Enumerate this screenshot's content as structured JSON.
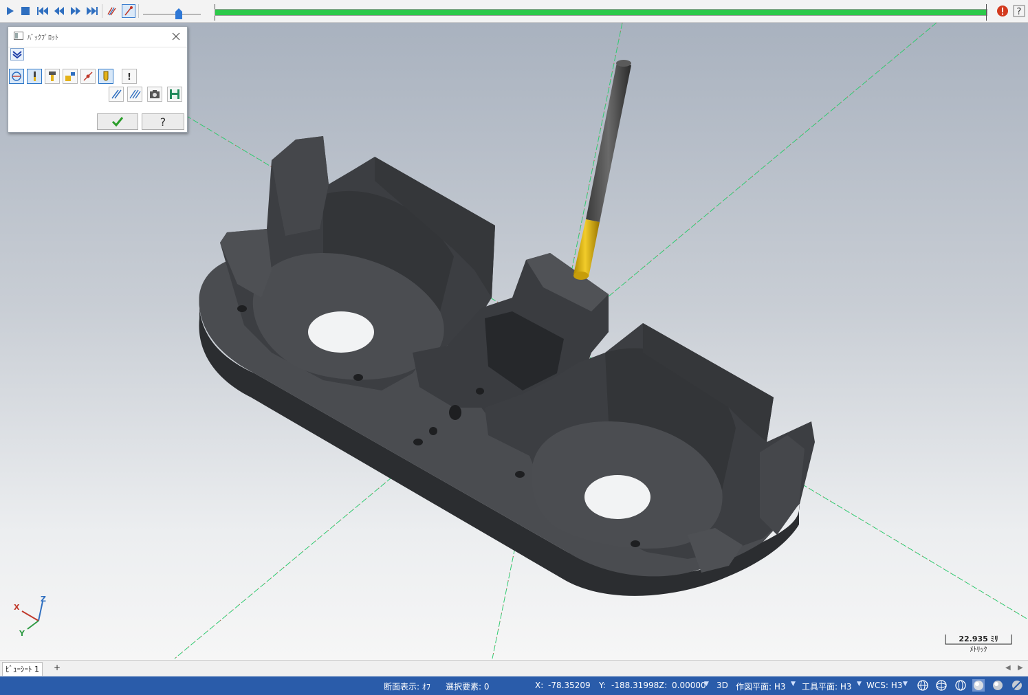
{
  "toolbar": {
    "buttons": [
      {
        "name": "play-icon"
      },
      {
        "name": "stop-icon"
      },
      {
        "name": "skip-to-start-icon"
      },
      {
        "name": "step-back-icon"
      },
      {
        "name": "step-forward-icon"
      },
      {
        "name": "skip-to-end-icon"
      },
      {
        "name": "toolpath-trace-icon"
      },
      {
        "name": "tool-display-icon"
      }
    ],
    "progress": 1.0,
    "speed": 0.62,
    "accent_color": "#2cc94a"
  },
  "dialog": {
    "title": "ﾊﾞｯｸﾌﾟﾛｯﾄ",
    "row1_icons": [
      "display-toolpath-icon",
      "display-tool-icon",
      "display-holder-icon",
      "display-rapid-icon",
      "display-entry-exit-icon",
      "display-shape-icon",
      "info-icon"
    ],
    "row2_icons": [
      "clear-toolpath-icon",
      "clear-all-icon",
      "screenshot-icon",
      "save-icon"
    ],
    "ok_icon": "checkmark-icon",
    "help_icon": "question-icon"
  },
  "viewport": {
    "axis_x": "X",
    "axis_y": "Y",
    "axis_z": "Z",
    "scale_value": "22.935 ﾐﾘ",
    "scale_unit": "ﾒﾄﾘｯｸ"
  },
  "tabs": {
    "sheet": "ﾋﾞｭｰｼｰﾄ 1",
    "add": "+"
  },
  "status": {
    "section_view": "断面表示: ｵﾌ",
    "selected": "選択要素: 0",
    "x_label": "X:",
    "x_value": "-78.35209",
    "y_label": "Y:",
    "y_value": "-188.31998",
    "z_label": "Z:",
    "z_value": "0.00000",
    "mode": "3D",
    "cplane": "作図平面: H3",
    "tplane": "工具平面: H3",
    "wcs": "WCS: H3",
    "bar_color": "#2a5caa"
  }
}
